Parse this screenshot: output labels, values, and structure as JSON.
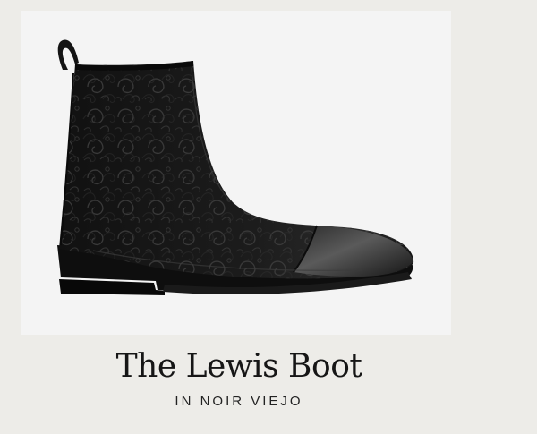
{
  "product": {
    "title": "The Lewis Boot",
    "subtitle": "IN NOIR VIEJO",
    "image_icon": "boot-product-image"
  },
  "colors": {
    "page_background": "#edece8",
    "image_background": "#f4f4f4",
    "boot_leather": "#1b1b1b",
    "title_text": "#161616"
  }
}
